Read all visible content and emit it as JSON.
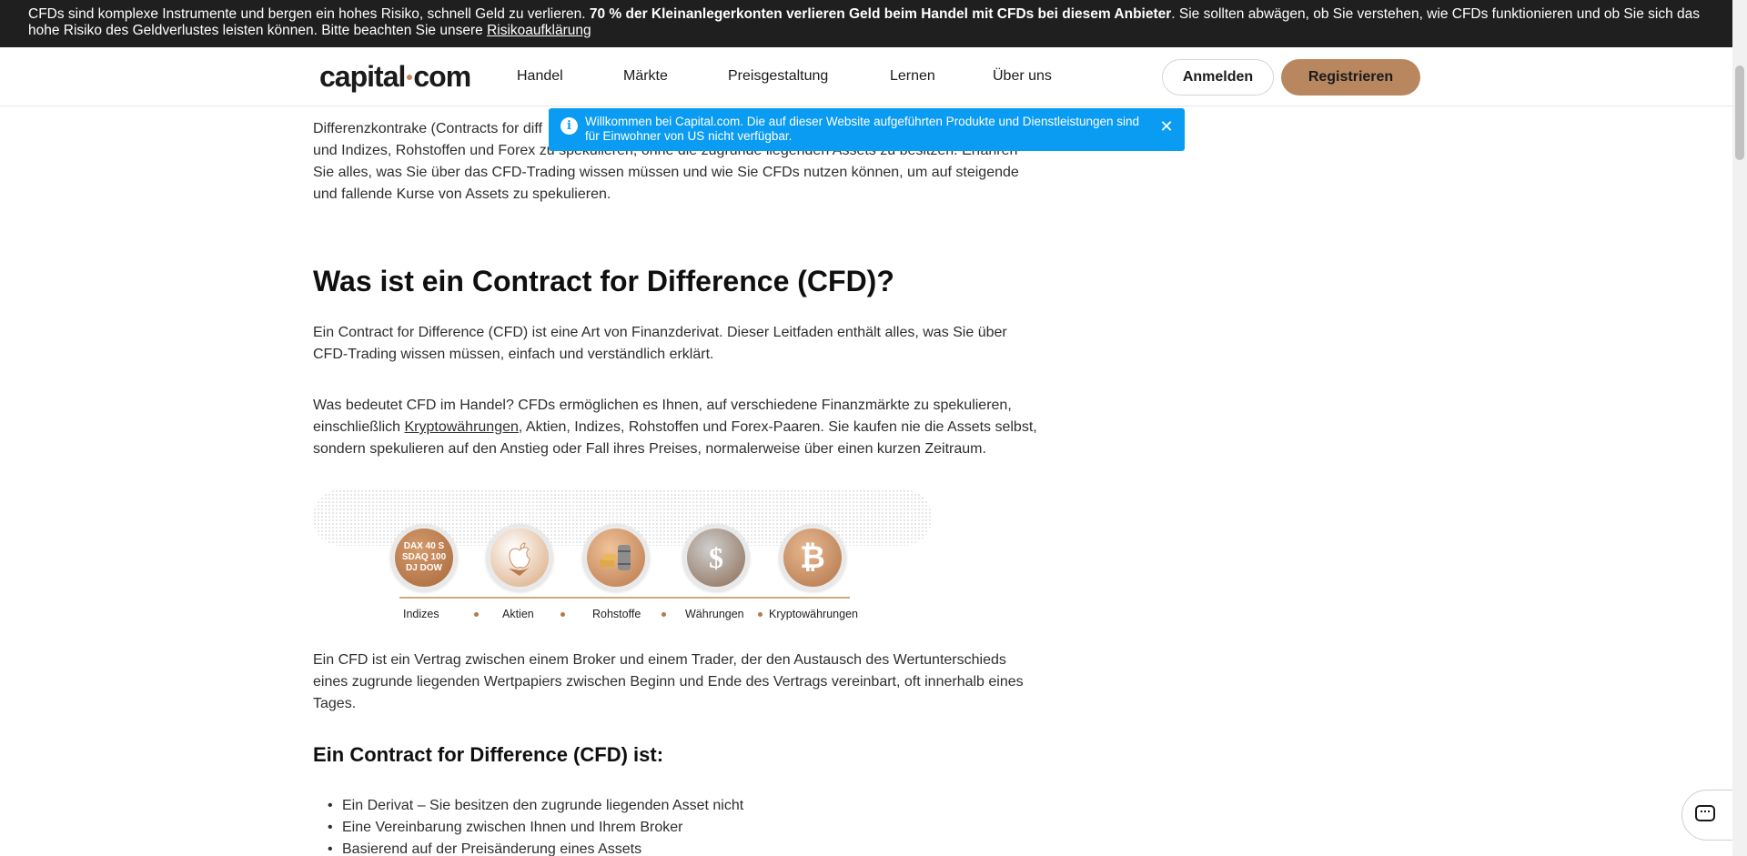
{
  "risk_banner": {
    "text_before": "CFDs sind komplexe Instrumente und bergen ein hohes Risiko, schnell Geld zu verlieren. ",
    "bold_text": "70 % der Kleinanlegerkonten verlieren Geld beim Handel mit CFDs bei diesem Anbieter",
    "text_after": ". Sie sollten abwägen, ob Sie verstehen, wie CFDs funktionieren und ob Sie sich das hohe Risiko des Geldverlustes leisten können. Bitte beachten Sie unsere ",
    "link_label": "Risikoaufklärung"
  },
  "header": {
    "logo_left": "capital",
    "logo_right": "com",
    "nav": [
      "Handel",
      "Märkte",
      "Preisgestaltung",
      "Lernen",
      "Über uns"
    ],
    "login_label": "Anmelden",
    "register_label": "Registrieren"
  },
  "toast": {
    "info_icon": "i",
    "close_icon": "✕",
    "message": "Willkommen bei Capital.com. Die auf dieser Website aufgeführten Produkte und Dienstleistungen sind für Einwohner von US nicht verfügbar."
  },
  "article": {
    "intro_line1": "Differenzkontrake (Contracts for diff",
    "intro_rest": "und Indizes, Rohstoffen und Forex zu spekulieren, ohne die zugrunde liegenden Assets zu besitzen. Erfahren Sie alles, was Sie über das CFD-Trading wissen müssen und wie Sie CFDs nutzen können, um auf steigende und fallende Kurse von Assets zu spekulieren.",
    "heading1": "Was ist ein Contract for Difference (CFD)?",
    "para1": "Ein Contract for Difference (CFD) ist eine Art von Finanzderivat. Dieser Leitfaden enthält alles, was Sie über CFD-Trading wissen müssen, einfach und verständlich erklärt.",
    "para2_before": "Was bedeutet CFD im Handel? CFDs ermöglichen es Ihnen, auf verschiedene Finanzmärkte zu spekulieren, einschließlich ",
    "para2_link": "Kryptowährungen",
    "para2_after": ", Aktien, Indizes, Rohstoffen und Forex-Paaren. Sie kaufen nie die Assets selbst, sondern spekulieren auf den Anstieg oder Fall ihres Preises, normalerweise über einen kurzen Zeitraum.",
    "para3": "Ein CFD ist ein Vertrag zwischen einem Broker und einem Trader, der den Austausch des Wertunterschieds eines zugrunde liegenden Wertpapiers zwischen Beginn und Ende des Vertrags vereinbart, oft innerhalb eines Tages.",
    "heading2": "Ein Contract for Difference (CFD) ist:",
    "bullets": [
      "Ein Derivat – Sie besitzen den zugrunde liegenden Asset nicht",
      "Eine Vereinbarung zwischen Ihnen und Ihrem Broker",
      "Basierend auf der Preisänderung eines Assets"
    ]
  },
  "assets": {
    "labels": [
      "Indizes",
      "Aktien",
      "Rohstoffe",
      "Währungen",
      "Kryptowährungen"
    ],
    "index_badge_lines": [
      "DAX 40 S",
      "SDAQ 100",
      "DJ DOW"
    ],
    "icons": [
      "indices-icon",
      "apple-icon",
      "commodities-icon",
      "currency-icon",
      "bitcoin-icon"
    ],
    "accent_color": "#b88760"
  },
  "colors": {
    "banner_bg": "#1f1f1f",
    "toast_bg": "#0a9cf2",
    "brand_accent": "#b88760"
  }
}
